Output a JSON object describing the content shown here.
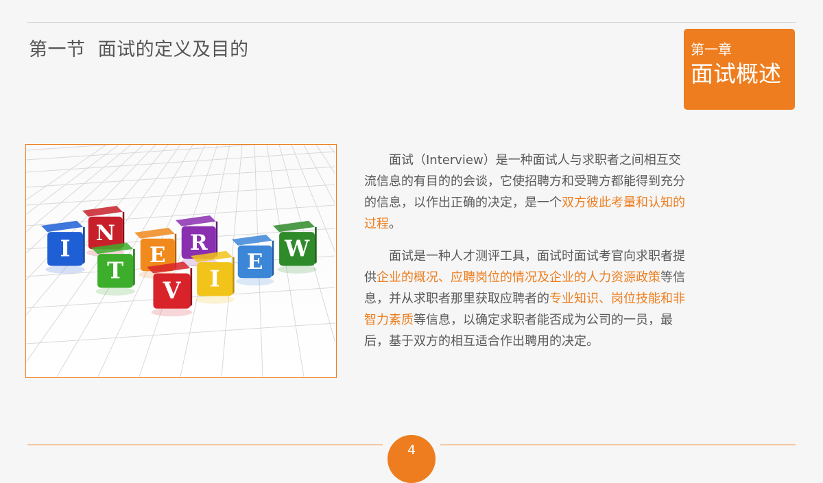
{
  "header": {
    "section_title": "第一节  面试的定义及目的",
    "chapter_label": "第一章",
    "chapter_title": "面试概述"
  },
  "image": {
    "letters": [
      "I",
      "N",
      "T",
      "E",
      "R",
      "V",
      "I",
      "E",
      "W"
    ]
  },
  "body": {
    "p1": [
      {
        "t": "面试（Interview）是一种面试人与求职者之间相互交流信息的有目的的会谈，它使招聘方和受聘方都能得到充分的信息，以作出正确的决定，是一个",
        "hl": false
      },
      {
        "t": "双方彼此考量和认知的过程",
        "hl": true
      },
      {
        "t": "。",
        "hl": false
      }
    ],
    "p2": [
      {
        "t": "面试是一种人才测评工具，面试时面试考官向求职者提供",
        "hl": false
      },
      {
        "t": "企业的概况、应聘岗位的情况及企业的人力资源政策",
        "hl": true
      },
      {
        "t": "等信息，并从求职者那里获取应聘者的",
        "hl": false
      },
      {
        "t": "专业知识、岗位技能和非智力素质",
        "hl": true
      },
      {
        "t": "等信息，以确定求职者能否成为公司的一员，最后，基于双方的相互适合作出聘用的决定。",
        "hl": false
      }
    ]
  },
  "footer": {
    "page_number": "4"
  },
  "colors": {
    "accent": "#ed7d1e",
    "text": "#595959",
    "background": "#f6f6f6"
  }
}
